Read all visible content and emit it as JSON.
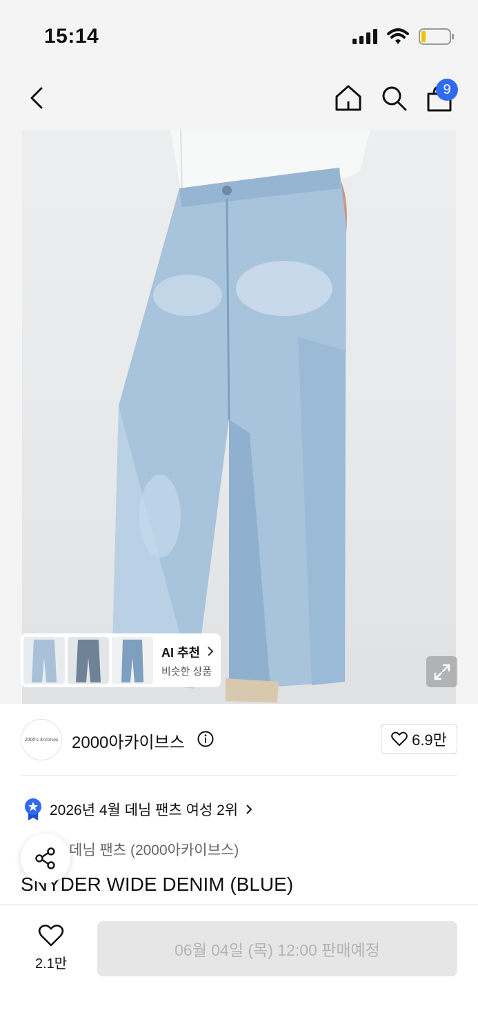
{
  "status_bar": {
    "time": "15:14"
  },
  "nav": {
    "cart_count": "9"
  },
  "ai_recommend": {
    "title": "AI 추천",
    "subtitle": "비슷한 상품"
  },
  "brand": {
    "logo_text": "2000's Archives",
    "name": "2000아카이브스",
    "likes": "6.9만"
  },
  "ranking": {
    "text": "2026년 4월 데님 팬츠 여성 2위"
  },
  "product": {
    "category": "데님 팬츠 (2000아카이브스)",
    "title": "SNYDER WIDE DENIM (BLUE)"
  },
  "bottom": {
    "wish_count": "2.1만",
    "sale_button": "06월 04일 (목) 12:00 판매예정"
  },
  "colors": {
    "accent": "#2f6bf0",
    "denim": "#9bbad6"
  }
}
